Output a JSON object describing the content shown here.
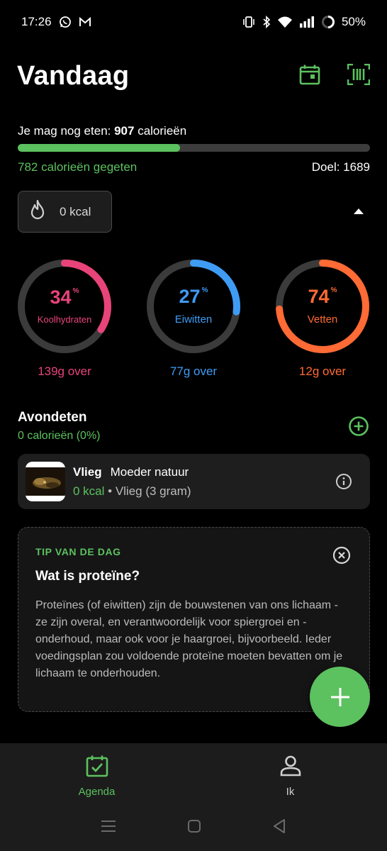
{
  "status_bar": {
    "time": "17:26",
    "battery": "50%",
    "icons": [
      "whatsapp-icon",
      "gmail-icon",
      "vibrate-icon",
      "bluetooth-icon",
      "wifi-icon",
      "signal-icon",
      "battery-ring-icon"
    ]
  },
  "header": {
    "title": "Vandaag",
    "icons": [
      "calendar-icon",
      "barcode-scanner-icon"
    ]
  },
  "budget": {
    "remaining_prefix": "Je mag nog eten: ",
    "remaining_value": "907",
    "remaining_suffix": " calorieën",
    "eaten_label": "782 calorieën gegeten",
    "goal_label": "Doel: 1689",
    "progress_fraction": 0.46
  },
  "burned": {
    "label": "0 kcal",
    "icon": "flame-icon"
  },
  "macros": [
    {
      "percent": "34",
      "unit": "%",
      "name": "Koolhydraten",
      "remaining": "139g over",
      "fraction": 0.34,
      "color": "#e8447a"
    },
    {
      "percent": "27",
      "unit": "%",
      "name": "Eiwitten",
      "remaining": "77g over",
      "fraction": 0.27,
      "color": "#3f9cf5"
    },
    {
      "percent": "74",
      "unit": "%",
      "name": "Vetten",
      "remaining": "12g over",
      "fraction": 0.74,
      "color": "#ff6a35"
    }
  ],
  "meal": {
    "title": "Avondeten",
    "subtitle": "0 calorieën (0%)",
    "items": [
      {
        "name": "Vlieg",
        "brand": "Moeder natuur",
        "kcal": "0 kcal",
        "detail": " • Vlieg (3 gram)"
      }
    ]
  },
  "tip": {
    "label": "TIP VAN DE DAG",
    "title": "Wat is proteïne?",
    "body": "Proteïnes (of eiwitten) zijn de bouwstenen van ons lichaam - ze zijn overal, en verantwoordelijk voor spiergroei en -onderhoud, maar ook voor je haargroei, bijvoorbeeld. Ieder voedingsplan zou voldoende proteïne moeten bevatten om je lichaam te onderhouden."
  },
  "bottom_nav": [
    {
      "label": "Agenda",
      "icon": "calendar-check-icon",
      "active": true
    },
    {
      "label": "Ik",
      "icon": "person-icon",
      "active": false
    }
  ],
  "colors": {
    "accent": "#5cc15f",
    "carbs": "#e8447a",
    "protein": "#3f9cf5",
    "fat": "#ff6a35",
    "ring_track": "#3b3b3b"
  }
}
